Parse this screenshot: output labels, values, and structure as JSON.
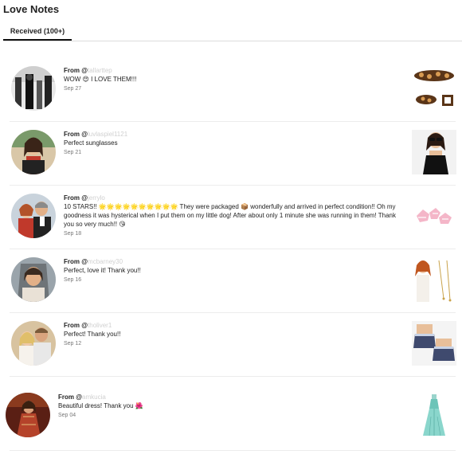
{
  "header": {
    "title": "Love Notes"
  },
  "tabs": [
    {
      "label": "Received",
      "count": "(100+)"
    }
  ],
  "notes": [
    {
      "from_prefix": "From @",
      "username": "tallarttep",
      "message": "WOW 😍 I LOVE THEM!!!",
      "date": "Sep 27"
    },
    {
      "from_prefix": "From @",
      "username": "luvlaspiel1121",
      "message": "Perfect sunglasses",
      "date": "Sep 21"
    },
    {
      "from_prefix": "From @",
      "username": "jerrylo",
      "message": "10 STARS!! 🌟🌟🌟🌟🌟🌟🌟🌟🌟🌟 They were packaged 📦 wonderfully and arrived in perfect condition!! Oh my goodness it was hysterical when I put them on my little dog! After about only 1 minute she was running in them! Thank you so very much!! 😘",
      "date": "Sep 18"
    },
    {
      "from_prefix": "From @",
      "username": "mcbarney30",
      "message": "Perfect, love it! Thank you!!",
      "date": "Sep 16"
    },
    {
      "from_prefix": "From @",
      "username": "tholiver1",
      "message": "Perfect! Thank you!!",
      "date": "Sep 12"
    },
    {
      "from_prefix": "From @",
      "username": "amkucia",
      "message": "Beautiful dress! Thank you 🌺",
      "date": "Sep 04"
    }
  ],
  "colors": {
    "accent_underline": "#111111",
    "divider": "#ececec",
    "username": "#d0d0d0"
  }
}
